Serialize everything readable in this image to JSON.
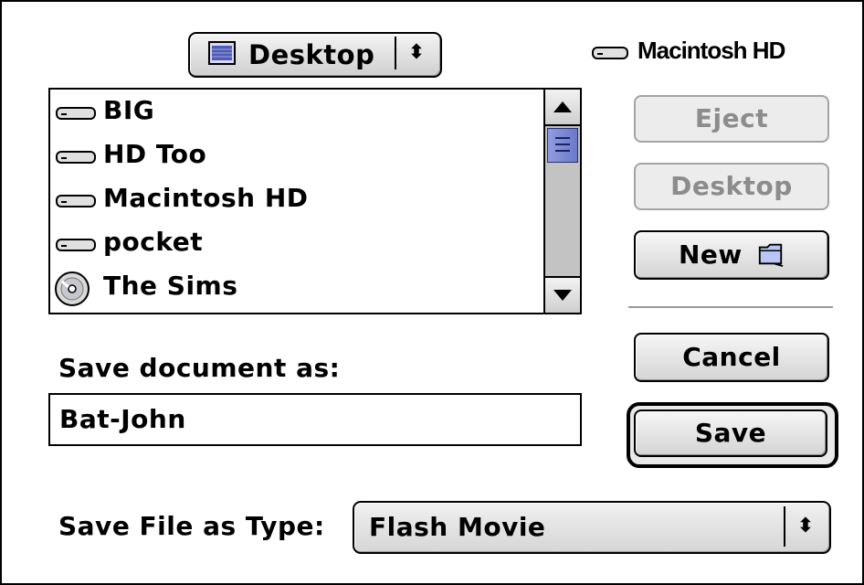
{
  "location_popup": {
    "label": "Desktop",
    "icon": "desktop-icon",
    "arrows_glyph": "⬍"
  },
  "volume": {
    "name": "Macintosh HD",
    "icon": "hard-disk-icon"
  },
  "file_list": {
    "items": [
      {
        "name": "BIG",
        "icon": "hard-disk-icon"
      },
      {
        "name": "HD Too",
        "icon": "hard-disk-icon"
      },
      {
        "name": "Macintosh HD",
        "icon": "hard-disk-icon"
      },
      {
        "name": "pocket",
        "icon": "hard-disk-icon"
      },
      {
        "name": "The Sims",
        "icon": "cd-disc-icon"
      }
    ]
  },
  "buttons": {
    "eject": "Eject",
    "desktop": "Desktop",
    "new": "New",
    "cancel": "Cancel",
    "save": "Save"
  },
  "save_as": {
    "label": "Save document as:",
    "value": "Bat-John"
  },
  "file_type": {
    "label": "Save File as Type:",
    "value": "Flash Movie",
    "arrows_glyph": "⬍"
  },
  "colors": {
    "scroll_thumb": "#7b88d4",
    "disabled_text": "#8c8c8c"
  }
}
